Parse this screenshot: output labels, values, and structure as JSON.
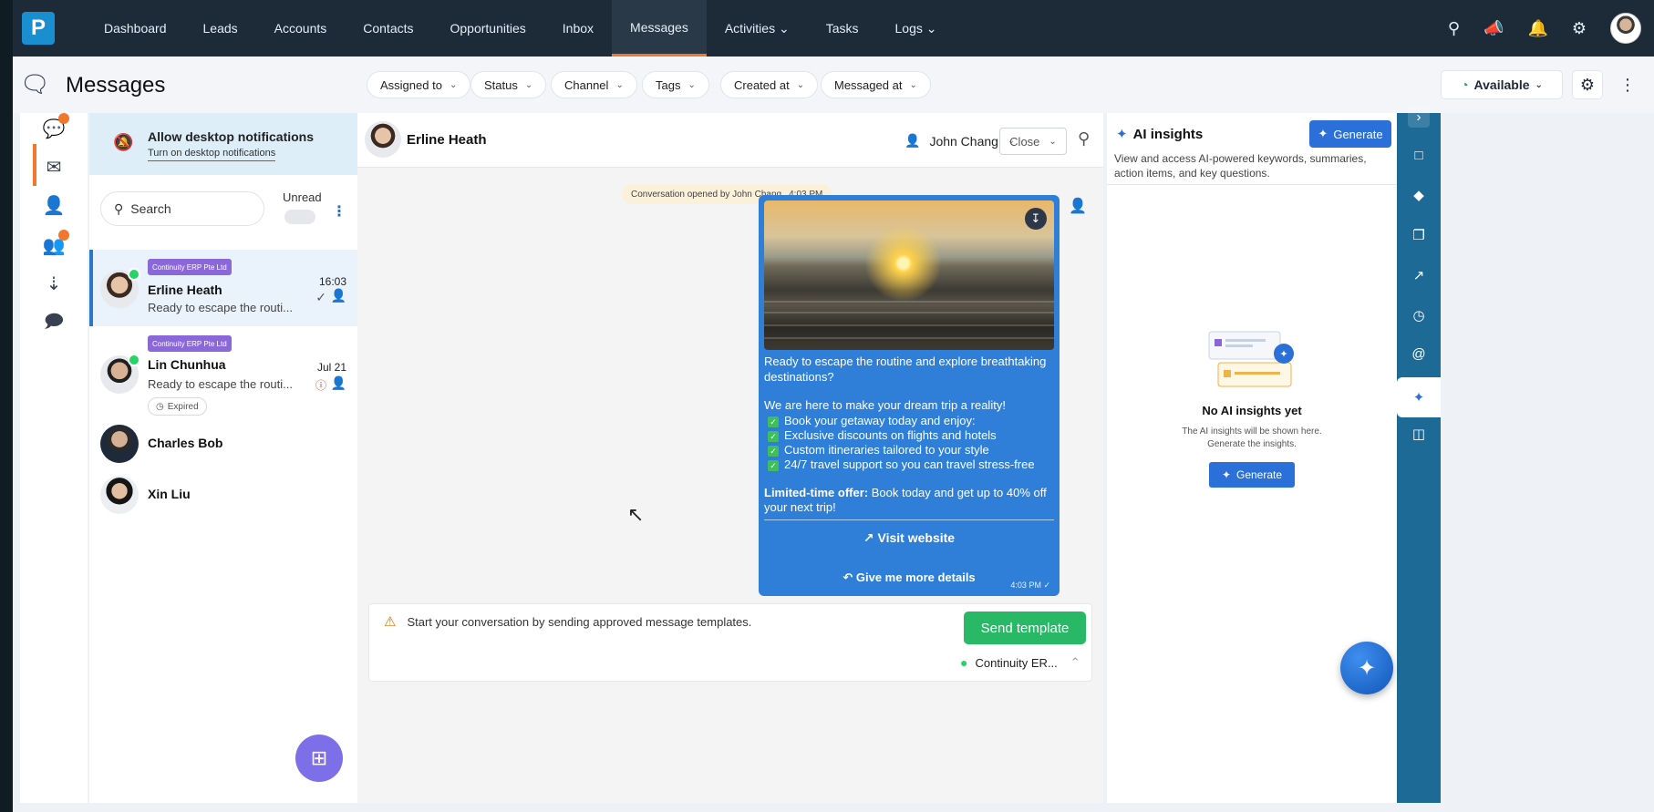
{
  "app": {
    "logo_letter": "P"
  },
  "nav": {
    "items": [
      {
        "label": "Dashboard"
      },
      {
        "label": "Leads"
      },
      {
        "label": "Accounts"
      },
      {
        "label": "Contacts"
      },
      {
        "label": "Opportunities"
      },
      {
        "label": "Inbox"
      },
      {
        "label": "Messages",
        "active": true
      },
      {
        "label": "Activities ⌄"
      },
      {
        "label": "Tasks"
      },
      {
        "label": "Logs ⌄"
      }
    ],
    "icons": [
      "search-icon",
      "megaphone-icon",
      "bell-icon",
      "gear-icon",
      "user-avatar"
    ]
  },
  "subheader": {
    "title": "Messages",
    "filters": [
      "Assigned to",
      "Status",
      "Channel",
      "Tags",
      "Created at",
      "Messaged at"
    ],
    "availability": "Available"
  },
  "notification": {
    "title": "Allow desktop notifications",
    "subtitle": "Turn on desktop notifications"
  },
  "list": {
    "search_placeholder": "Search",
    "unread_label": "Unread",
    "conversations": [
      {
        "tag": "Continuity ERP Pte Ltd",
        "name": "Erline Heath",
        "preview": "Ready to escape the routi...",
        "time": "16:03",
        "selected": true
      },
      {
        "tag": "Continuity ERP Pte Ltd",
        "name": "Lin Chunhua",
        "preview": "Ready to escape the routi...",
        "time": "Jul 21",
        "status": "Expired"
      },
      {
        "name": "Charles Bob"
      },
      {
        "name": "Xin Liu"
      }
    ]
  },
  "chat": {
    "contact_name": "Erline Heath",
    "agent_name": "John Chang",
    "close_label": "Close",
    "system_message": "Conversation opened by John Chang",
    "system_time": "4:03 PM",
    "message": {
      "line1": "Ready to escape the routine and explore breathtaking",
      "line2": "destinations?",
      "line3": "We are here to make your dream trip a reality!",
      "bullets": [
        "Book your getaway today and enjoy:",
        "Exclusive discounts on flights and hotels",
        "Custom itineraries tailored to your style",
        "24/7 travel support so you can travel stress-free"
      ],
      "offer_bold": "Limited-time offer:",
      "offer_rest": " Book today and get up to 40% off",
      "offer_line2": "your next trip!",
      "button1": "Visit website",
      "button2": "Give me more details",
      "time": "4:03 PM"
    },
    "composer_warning": "Start your conversation by sending approved message templates.",
    "send_template_label": "Send template",
    "channel_label": "Continuity ER..."
  },
  "ai": {
    "title": "AI insights",
    "generate_label": "Generate",
    "description": "View and access AI-powered keywords, summaries, action items, and key questions.",
    "empty_title": "No AI insights yet",
    "empty_line1": "The AI insights will be shown here.",
    "empty_line2": "Generate the insights."
  },
  "colors": {
    "nav_bg": "#1d2b39",
    "accent_orange": "#f0782d",
    "bubble_blue": "#2f7fd9",
    "send_green": "#29b866",
    "tag_purple": "#8b68d9",
    "right_rail": "#1d6a96"
  }
}
